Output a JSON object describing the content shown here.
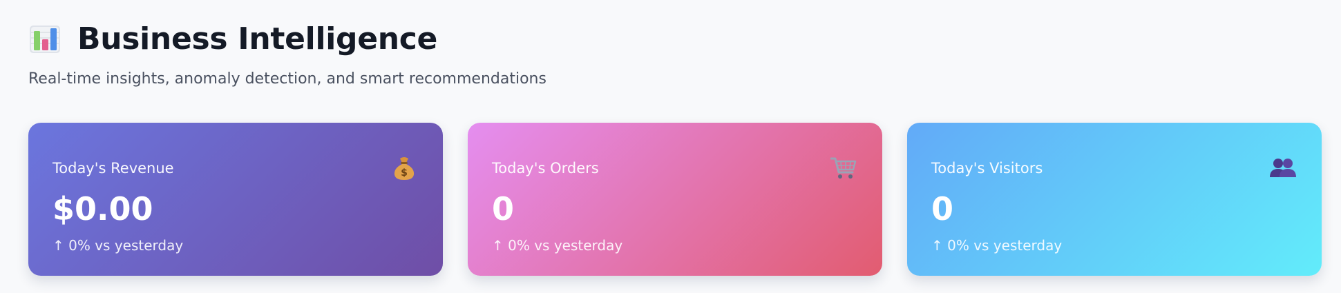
{
  "header": {
    "icon": "bar-chart-icon",
    "title": "Business Intelligence",
    "subtitle": "Real-time insights, anomaly detection, and smart recommendations"
  },
  "cards": [
    {
      "label": "Today's Revenue",
      "value": "$0.00",
      "change": "↑ 0% vs yesterday",
      "icon": "money-bag-icon",
      "gradient": [
        "#6b76de",
        "#6f4ea6"
      ]
    },
    {
      "label": "Today's Orders",
      "value": "0",
      "change": "↑ 0% vs yesterday",
      "icon": "shopping-cart-icon",
      "gradient": [
        "#e48ef0",
        "#e25c70"
      ]
    },
    {
      "label": "Today's Visitors",
      "value": "0",
      "change": "↑ 0% vs yesterday",
      "icon": "people-icon",
      "gradient": [
        "#62aaf8",
        "#62ecfa"
      ]
    }
  ]
}
